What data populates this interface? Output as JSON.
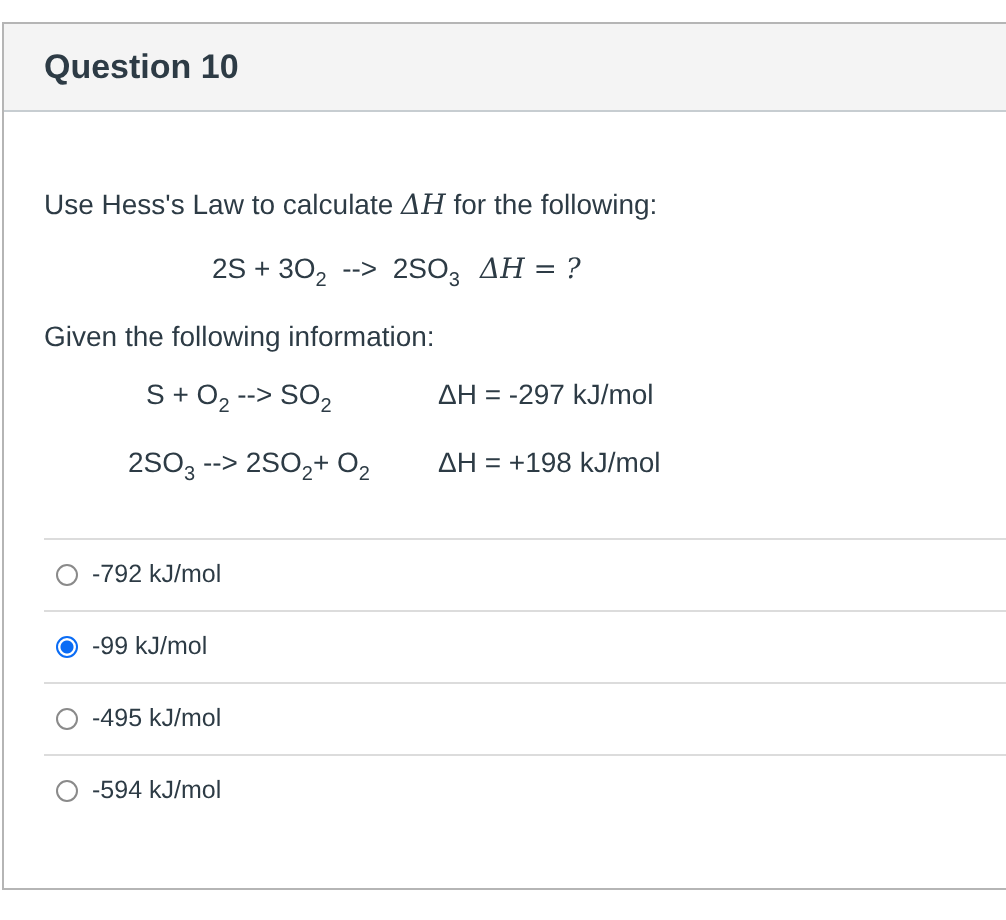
{
  "question": {
    "title": "Question 10",
    "prompt": {
      "before": "Use Hess's Law to calculate ",
      "math": "ΔH",
      "after": " for the following:"
    },
    "target": {
      "equation": "2S + 3O$_{2}$  -->  2SO$_{3}$",
      "enthalpy": "ΔH = ?"
    },
    "given_label": "Given the following information:",
    "given": [
      {
        "equation": "S + O$_{2}$ --> SO$_{2}$",
        "enthalpy": "ΔH = -297 kJ/mol"
      },
      {
        "equation": "2SO$_{3}$ --> 2SO$_{2}$+ O$_{2}$",
        "enthalpy": "ΔH = +198 kJ/mol"
      }
    ],
    "options": [
      {
        "label": "-792 kJ/mol",
        "selected": false
      },
      {
        "label": "-99 kJ/mol",
        "selected": true
      },
      {
        "label": "-495 kJ/mol",
        "selected": false
      },
      {
        "label": "-594 kJ/mol",
        "selected": false
      }
    ]
  }
}
